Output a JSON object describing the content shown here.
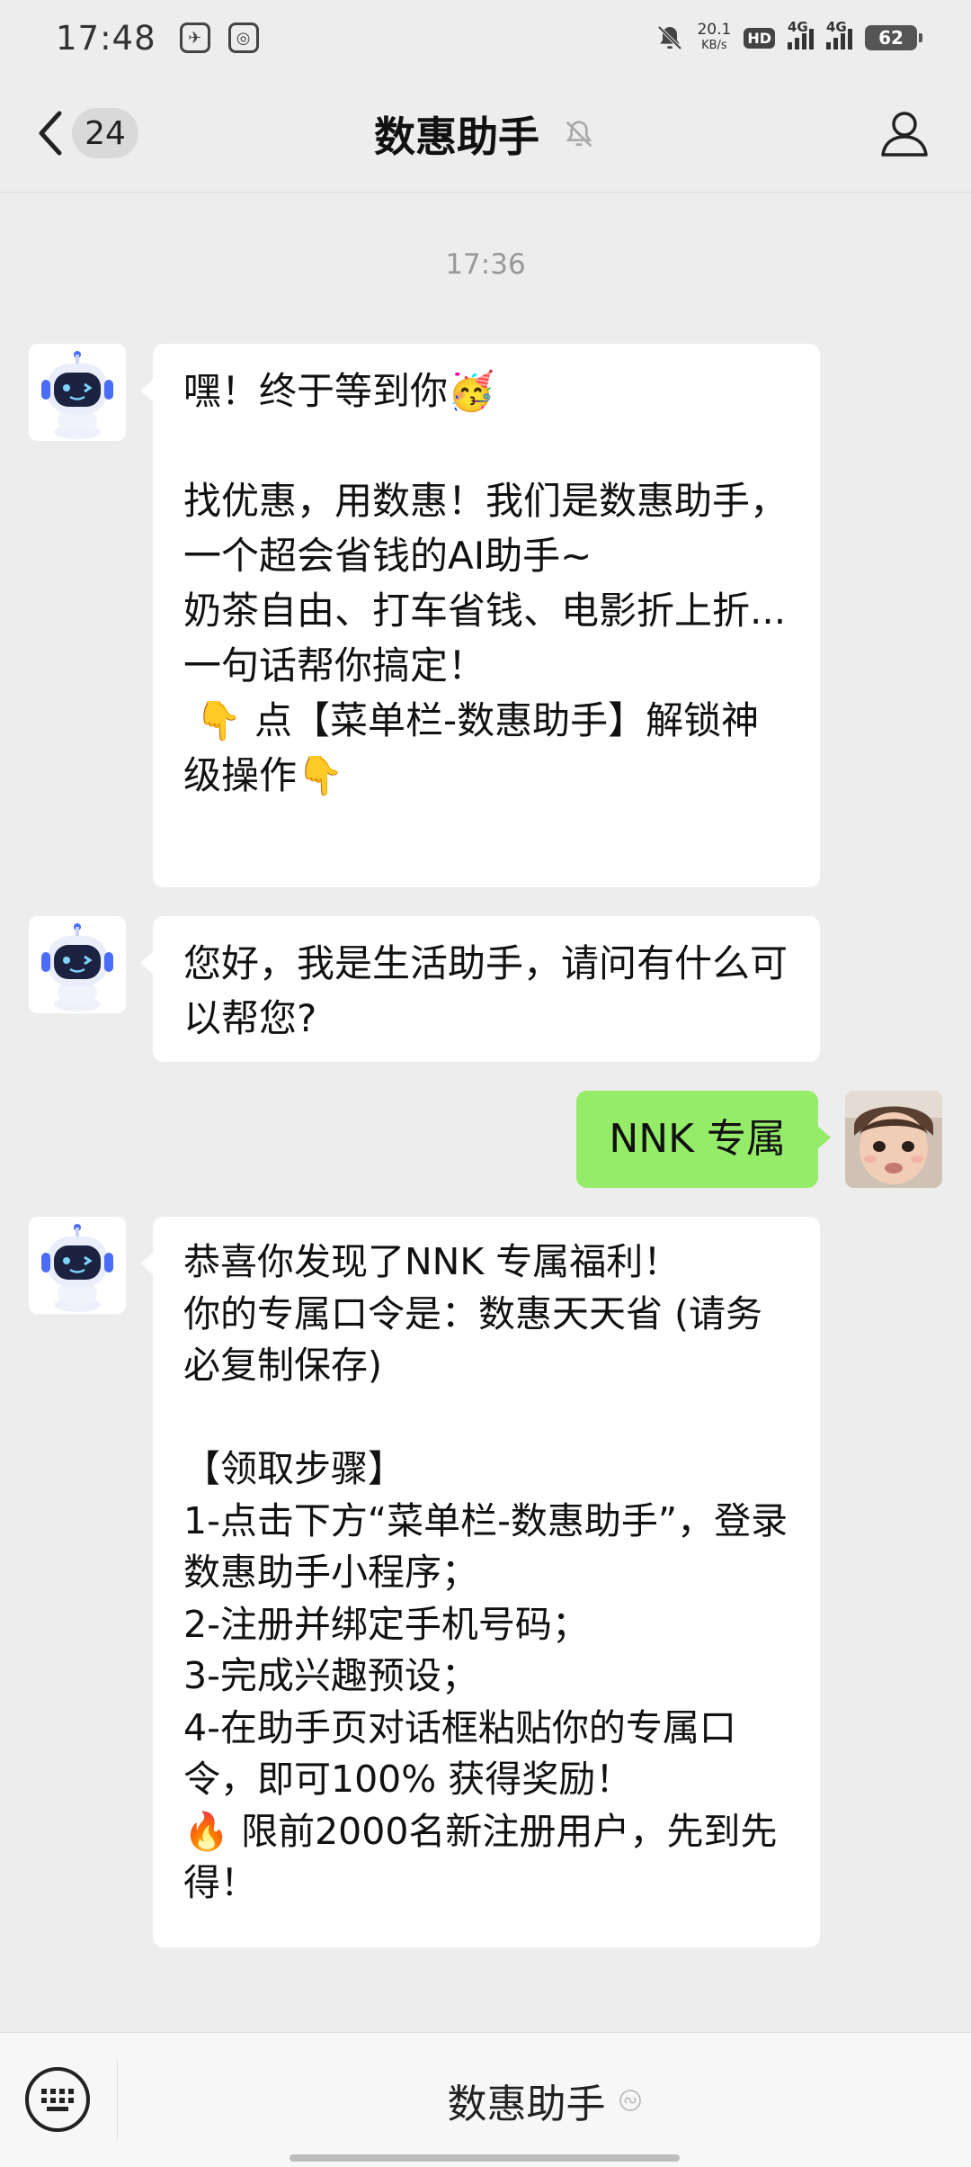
{
  "status_bar": {
    "time": "17:48",
    "net_speed": "20.1",
    "net_speed_unit": "KB/s",
    "hd_label": "HD",
    "signal1_label": "4G",
    "signal2_label": "4G",
    "battery": "62",
    "app_icons": [
      "ctrip-app-icon",
      "camera-app-icon"
    ]
  },
  "header": {
    "unread_count": "24",
    "title": "数惠助手",
    "icons": {
      "back": "chevron-left-icon",
      "mute": "bell-off-icon",
      "profile": "person-icon"
    }
  },
  "chat": {
    "timestamp": "17:36",
    "messages": [
      {
        "side": "left",
        "text": "嘿！终于等到你🥳\n\n找优惠，用数惠！我们是数惠助手，一个超会省钱的AI助手~\n奶茶自由、打车省钱、电影折上折... 一句话帮你搞定！\n 👇 点【菜单栏-数惠助手】解锁神级操作👇"
      },
      {
        "side": "left",
        "text": "您好，我是生活助手，请问有什么可以帮您?"
      },
      {
        "side": "right",
        "text": "NNK 专属"
      },
      {
        "side": "left",
        "text": "恭喜你发现了NNK 专属福利！\n你的专属口令是：数惠天天省 (请务必复制保存)\n\n【领取步骤】\n1-点击下方“菜单栏-数惠助手”，登录数惠助手小程序；\n2-注册并绑定手机号码；\n3-完成兴趣预设；\n4-在助手页对话框粘贴你的专属口令，即可100% 获得奖励！\n🔥 限前2000名新注册用户，先到先得！"
      }
    ]
  },
  "bottom_bar": {
    "menu_label": "数惠助手",
    "icons": {
      "keyboard": "keyboard-icon",
      "mini_program": "mini-program-icon"
    }
  },
  "colors": {
    "background": "#ededed",
    "bubble_self": "#95ec69",
    "bubble_other": "#ffffff"
  }
}
